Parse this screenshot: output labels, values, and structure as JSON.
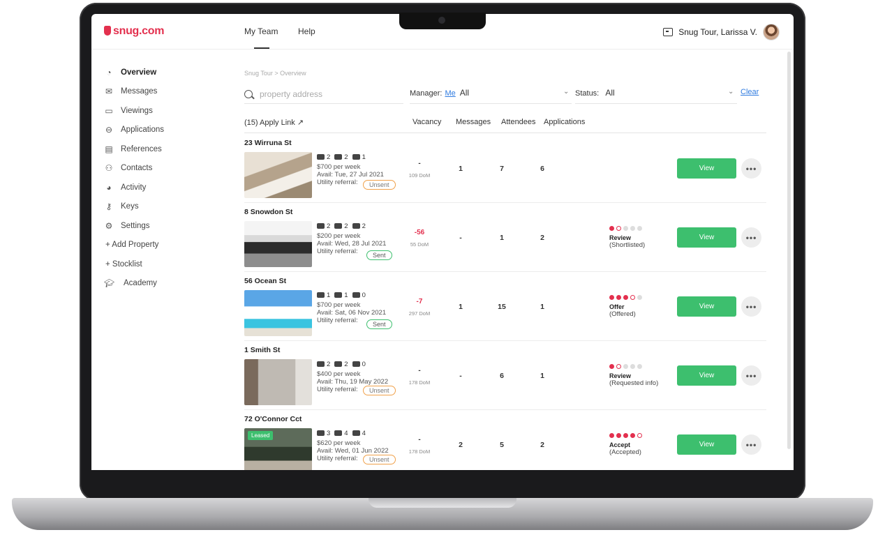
{
  "header": {
    "logo": "snug.com",
    "nav": [
      {
        "label": "My Team"
      },
      {
        "label": "Help"
      }
    ],
    "user_label": "Snug Tour,  Larissa V."
  },
  "sidebar": {
    "items": [
      {
        "label": "Overview",
        "icon": "gauge-icon"
      },
      {
        "label": "Messages",
        "icon": "mail-icon"
      },
      {
        "label": "Viewings",
        "icon": "calendar-icon"
      },
      {
        "label": "Applications",
        "icon": "chat-icon"
      },
      {
        "label": "References",
        "icon": "document-icon"
      },
      {
        "label": "Contacts",
        "icon": "person-add-icon"
      },
      {
        "label": "Activity",
        "icon": "pie-icon"
      },
      {
        "label": "Keys",
        "icon": "key-icon"
      },
      {
        "label": "Settings",
        "icon": "gear-icon"
      },
      {
        "label": "+ Add Property"
      },
      {
        "label": "+ Stocklist"
      },
      {
        "label": "Academy",
        "icon": "graduation-cap-icon"
      }
    ]
  },
  "breadcrumb": "Snug Tour  >  Overview",
  "search": {
    "placeholder": "property address"
  },
  "filters": {
    "manager_label": "Manager:",
    "manager_me": "Me",
    "manager_value": "All",
    "status_label": "Status:",
    "status_value": "All",
    "clear": "Clear"
  },
  "columns": {
    "apply_link": "(15) Apply Link",
    "vacancy": "Vacancy",
    "messages": "Messages",
    "attendees": "Attendees",
    "applications": "Applications"
  },
  "properties": [
    {
      "address": "23 Wirruna St",
      "beds": "2",
      "baths": "2",
      "cars": "1",
      "price": "$700 per week",
      "avail": "Avail: Tue, 27 Jul 2021",
      "utility": "Utility referral:",
      "badge": "Unsent",
      "badge_type": "unsent",
      "vacancy": "-",
      "dom": "109 DoM",
      "messages": "1",
      "attendees": "7",
      "applications": "6",
      "stage": "",
      "stage_sub": "",
      "progress": [],
      "view": "View",
      "more": "•••",
      "leased": ""
    },
    {
      "address": "8 Snowdon St",
      "beds": "2",
      "baths": "2",
      "cars": "2",
      "price": "$200 per week",
      "avail": "Avail: Wed, 28 Jul 2021",
      "utility": "Utility referral:",
      "badge": "Sent",
      "badge_type": "sent",
      "vacancy": "-56",
      "dom": "55 DoM",
      "messages": "-",
      "attendees": "1",
      "applications": "2",
      "stage": "Review",
      "stage_sub": "(Shortlisted)",
      "progress": [
        "f",
        "o",
        "e",
        "e",
        "e"
      ],
      "view": "View",
      "more": "•••",
      "leased": ""
    },
    {
      "address": "56 Ocean St",
      "beds": "1",
      "baths": "1",
      "cars": "0",
      "price": "$700 per week",
      "avail": "Avail: Sat, 06 Nov 2021",
      "utility": "Utility referral:",
      "badge": "Sent",
      "badge_type": "sent",
      "vacancy": "-7",
      "dom": "297 DoM",
      "messages": "1",
      "attendees": "15",
      "applications": "1",
      "stage": "Offer",
      "stage_sub": "(Offered)",
      "progress": [
        "f",
        "f",
        "f",
        "o",
        "e"
      ],
      "view": "View",
      "more": "•••",
      "leased": ""
    },
    {
      "address": "1 Smith St",
      "beds": "2",
      "baths": "2",
      "cars": "0",
      "price": "$400 per week",
      "avail": "Avail: Thu, 19 May 2022",
      "utility": "Utility referral:",
      "badge": "Unsent",
      "badge_type": "unsent",
      "vacancy": "-",
      "dom": "178 DoM",
      "messages": "-",
      "attendees": "6",
      "applications": "1",
      "stage": "Review",
      "stage_sub": "(Requested info)",
      "progress": [
        "f",
        "o",
        "e",
        "e",
        "e"
      ],
      "view": "View",
      "more": "•••",
      "leased": ""
    },
    {
      "address": "72 O'Connor Cct",
      "beds": "3",
      "baths": "4",
      "cars": "4",
      "price": "$620 per week",
      "avail": "Avail: Wed, 01 Jun 2022",
      "utility": "Utility referral:",
      "badge": "Unsent",
      "badge_type": "unsent",
      "vacancy": "-",
      "dom": "178 DoM",
      "messages": "2",
      "attendees": "5",
      "applications": "2",
      "stage": "Accept",
      "stage_sub": "(Accepted)",
      "progress": [
        "f",
        "f",
        "f",
        "f",
        "o"
      ],
      "view": "View",
      "more": "•••",
      "leased": "Leased"
    }
  ],
  "colors": {
    "brand": "#e3304e",
    "accent_green": "#3dbf6e",
    "link_blue": "#2f7be0"
  }
}
